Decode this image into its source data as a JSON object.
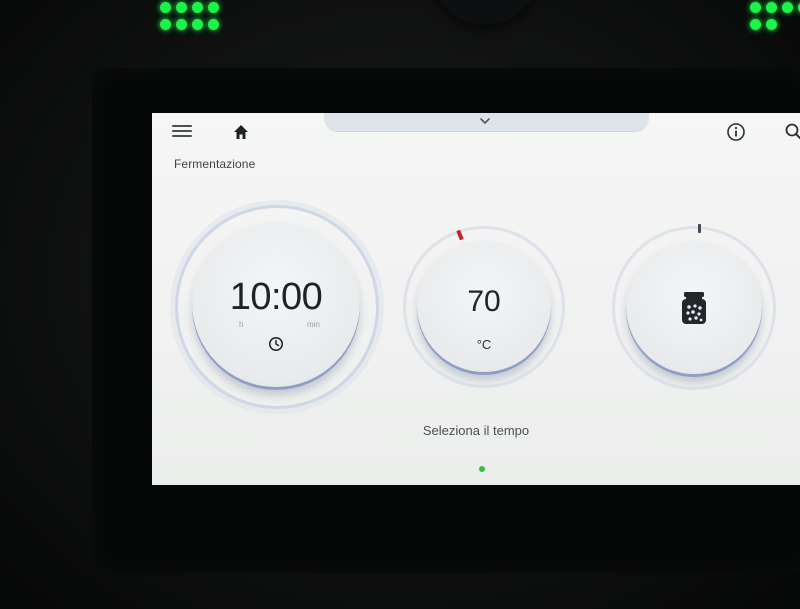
{
  "screen": {
    "mode_title": "Fermentazione",
    "time": {
      "value": "10:00",
      "unit_hours": "h",
      "unit_minutes": "min"
    },
    "temperature": {
      "value": "70",
      "unit": "°C"
    },
    "hint_text": "Seleziona il tempo",
    "page_indicator": {
      "current_page": 1
    }
  },
  "icons": {
    "menu": "hamburger-menu-icon",
    "home": "home-icon",
    "pulldown": "chevron-down-icon",
    "info": "info-icon",
    "search": "search-icon",
    "clock": "clock-icon",
    "jar": "jar-icon"
  },
  "colors": {
    "led_green": "#1ef24a",
    "screen_background": "#f2f3f2",
    "dial_accent": "#8f9fc4",
    "temperature_marker": "#c7242c",
    "page_dot": "#2fbf4a"
  }
}
